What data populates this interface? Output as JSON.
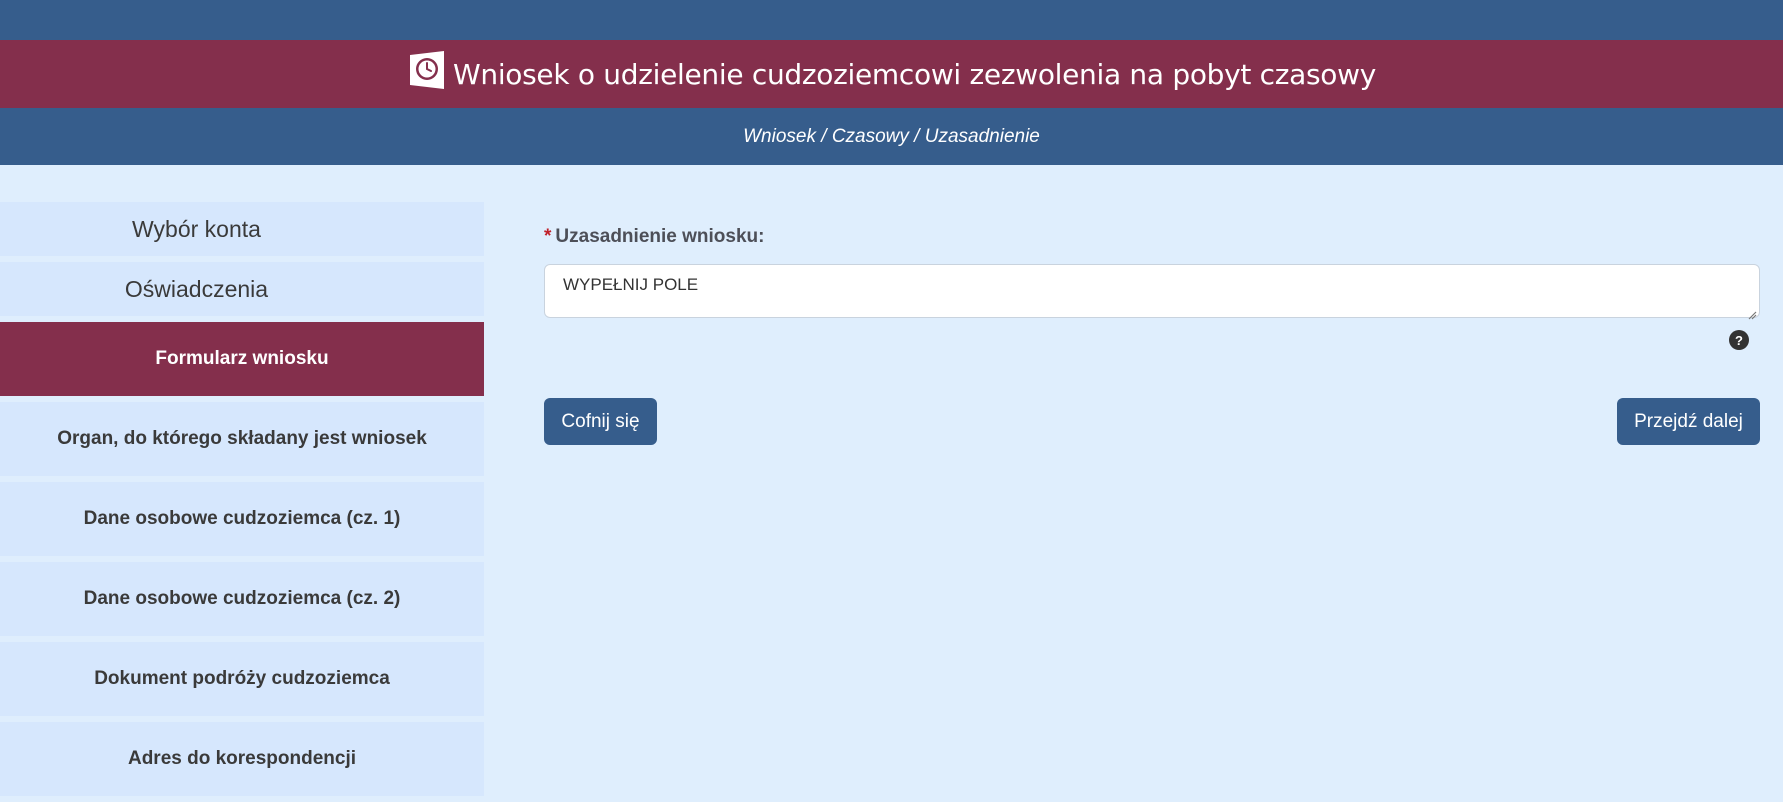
{
  "header": {
    "title": "Wniosek o udzielenie cudzoziemcowi zezwolenia na pobyt czasowy",
    "title_icon": "clock-document-icon",
    "breadcrumb": "Wniosek / Czasowy / Uzasadnienie"
  },
  "sidebar": {
    "items": [
      {
        "label": "Wybór konta",
        "active": false
      },
      {
        "label": "Oświadczenia",
        "active": false
      },
      {
        "label": "Formularz wniosku",
        "active": true
      },
      {
        "label": "Organ, do którego składany jest wniosek",
        "active": false
      },
      {
        "label": "Dane osobowe cudzoziemca (cz. 1)",
        "active": false
      },
      {
        "label": "Dane osobowe cudzoziemca (cz. 2)",
        "active": false
      },
      {
        "label": "Dokument podróży cudzoziemca",
        "active": false
      },
      {
        "label": "Adres do korespondencji",
        "active": false
      }
    ]
  },
  "form": {
    "required_marker": "*",
    "justification_label": "Uzasadnienie wniosku:",
    "justification_value": "WYPEŁNIJ POLE",
    "help_icon": "question-circle-icon",
    "help_glyph": "?"
  },
  "buttons": {
    "back_label": "Cofnij się",
    "next_label": "Przejdź dalej"
  },
  "colors": {
    "navy": "#365d8c",
    "maroon": "#842f4c",
    "background": "#dfeefd",
    "sidebar_item": "#d6e7fd"
  }
}
